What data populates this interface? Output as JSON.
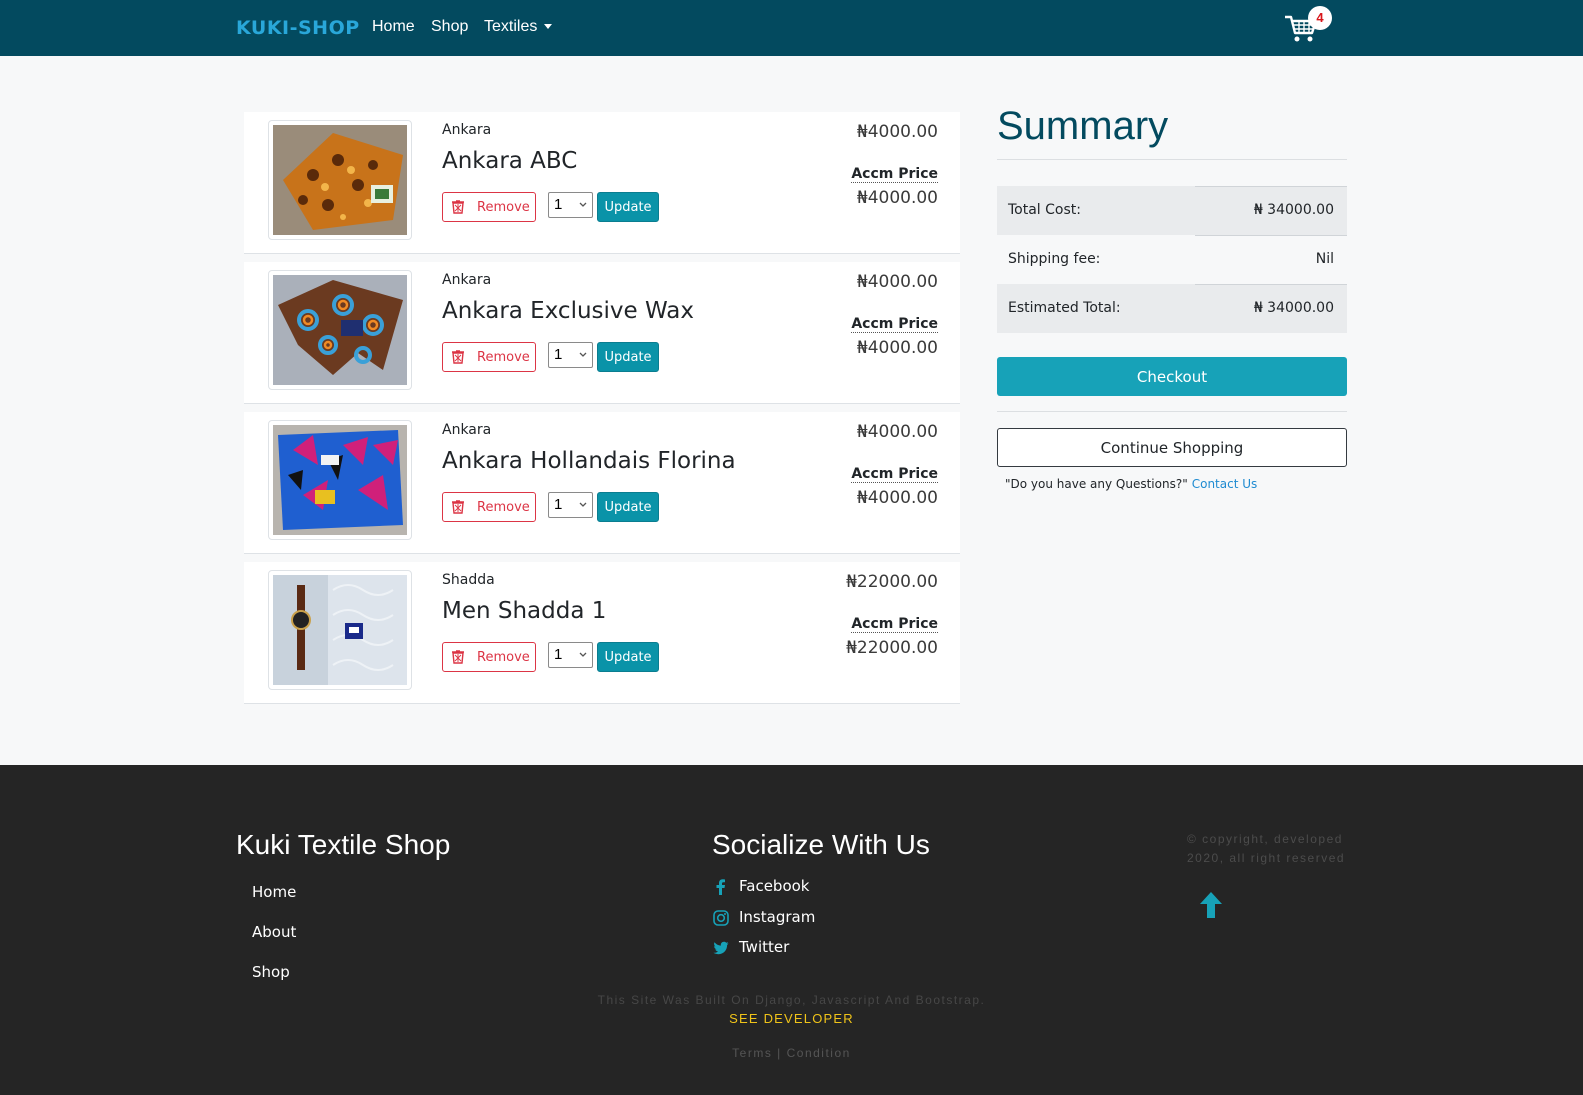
{
  "navbar": {
    "brand": "KUKI-SHOP",
    "links": [
      "Home",
      "Shop",
      "Textiles"
    ],
    "cart_count": "4",
    "colors": {
      "bg": "#034a5f",
      "brand": "#29a7d9"
    }
  },
  "cart": {
    "remove_label": "Remove",
    "update_label": "Update",
    "accm_label": "Accm Price",
    "items": [
      {
        "category": "Ankara",
        "name": "Ankara ABC",
        "price": "₦4000.00",
        "accm_price": "₦4000.00",
        "qty": "1",
        "image_icon": "ankara-orange-fabric"
      },
      {
        "category": "Ankara",
        "name": "Ankara Exclusive Wax",
        "price": "₦4000.00",
        "accm_price": "₦4000.00",
        "qty": "1",
        "image_icon": "ankara-circles-fabric"
      },
      {
        "category": "Ankara",
        "name": "Ankara Hollandais Florina",
        "price": "₦4000.00",
        "accm_price": "₦4000.00",
        "qty": "1",
        "image_icon": "ankara-blue-pink-fabric"
      },
      {
        "category": "Shadda",
        "name": "Men Shadda 1",
        "price": "₦22000.00",
        "accm_price": "₦22000.00",
        "qty": "1",
        "image_icon": "shadda-fabric-with-watch"
      }
    ]
  },
  "summary": {
    "title": "Summary",
    "total_cost_label": "Total Cost:",
    "total_cost_value": "₦ 34000.00",
    "shipping_label": "Shipping fee:",
    "shipping_value": "Nil",
    "estimated_label": "Estimated Total:",
    "estimated_value": "₦ 34000.00",
    "checkout_label": "Checkout",
    "continue_label": "Continue Shopping",
    "question_text": "\"Do you have any Questions?\"",
    "contact_label": "Contact Us",
    "colors": {
      "checkout": "#17a2b8",
      "title": "#034a5f",
      "link": "#1f8bd1"
    }
  },
  "footer": {
    "shop_title": "Kuki Textile Shop",
    "links": [
      "Home",
      "About",
      "Shop"
    ],
    "social_title": "Socialize With Us",
    "social": [
      {
        "label": "Facebook",
        "icon": "facebook-icon"
      },
      {
        "label": "Instagram",
        "icon": "instagram-icon"
      },
      {
        "label": "Twitter",
        "icon": "twitter-icon"
      }
    ],
    "copyright": "© copyright, developed 2020, all right reserved",
    "built_with": "This Site Was Built On Django, Javascript And Bootstrap.",
    "see_developer": "SEE DEVELOPER",
    "terms": "Terms | Condition",
    "colors": {
      "bg": "#252525",
      "accent": "#f0c419",
      "icon": "#17a2b8"
    }
  }
}
